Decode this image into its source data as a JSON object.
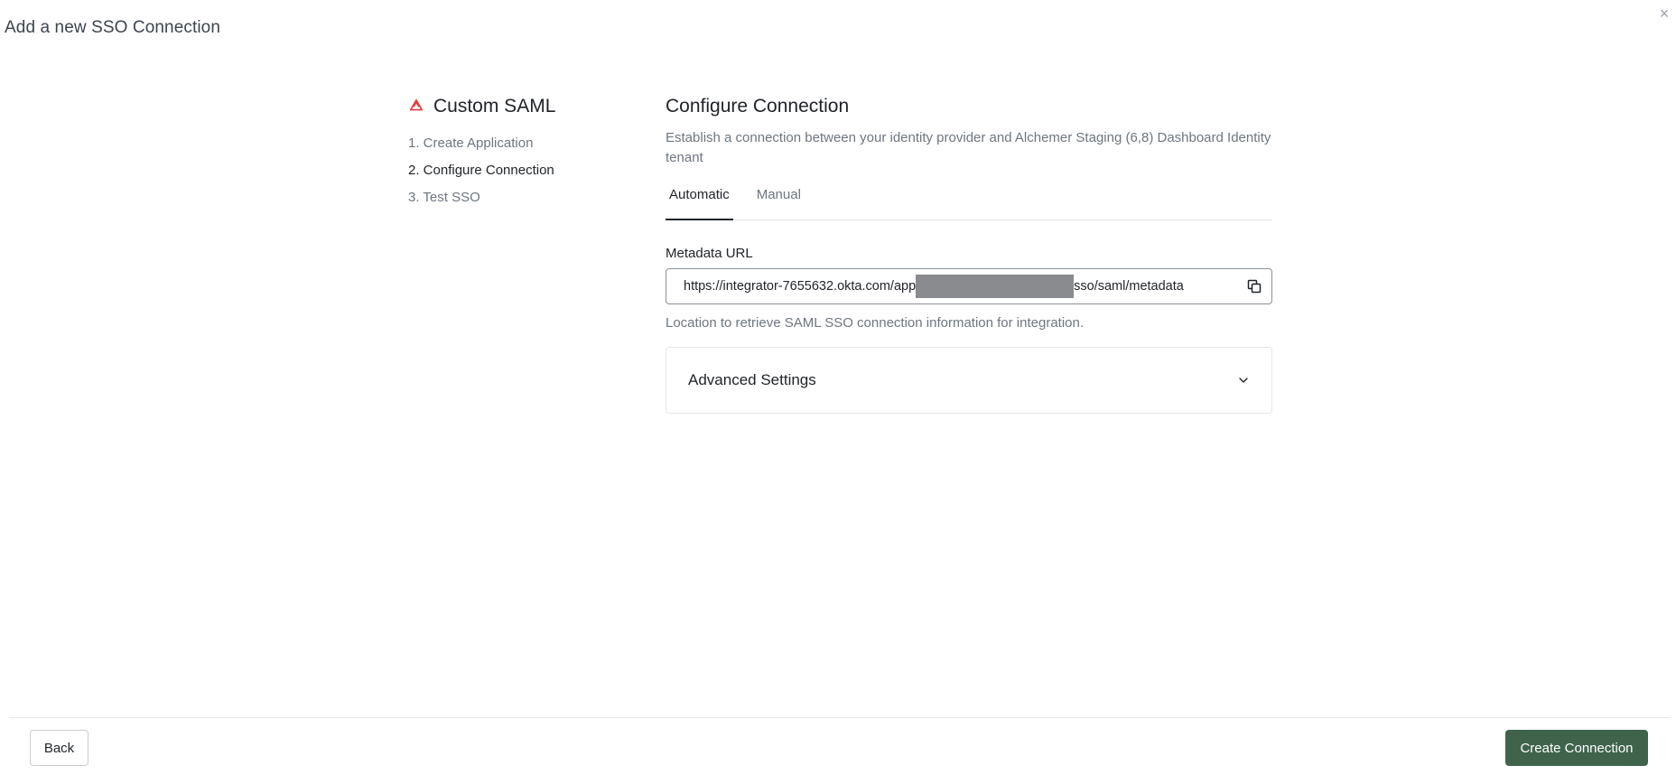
{
  "modal": {
    "title": "Add a new SSO Connection",
    "close_glyph": "×"
  },
  "steps": {
    "icon": "saml-icon",
    "title": "Custom SAML",
    "items": [
      {
        "label": "1. Create Application",
        "active": false
      },
      {
        "label": "2. Configure Connection",
        "active": true
      },
      {
        "label": "3. Test SSO",
        "active": false
      }
    ]
  },
  "main": {
    "title": "Configure Connection",
    "description": "Establish a connection between your identity provider and Alchemer Staging (6,8) Dashboard Identity tenant",
    "tabs": [
      {
        "label": "Automatic",
        "active": true
      },
      {
        "label": "Manual",
        "active": false
      }
    ],
    "metadata": {
      "label": "Metadata URL",
      "url_prefix": "https://integrator-7655632.okta.com/app",
      "url_suffix": "sso/saml/metadata",
      "help": "Location to retrieve SAML SSO connection information for integration."
    },
    "advanced": {
      "title": "Advanced Settings"
    }
  },
  "footer": {
    "back_label": "Back",
    "create_label": "Create Connection"
  },
  "colors": {
    "primary": "#3f634b",
    "brand_icon": "#e03a3e"
  }
}
